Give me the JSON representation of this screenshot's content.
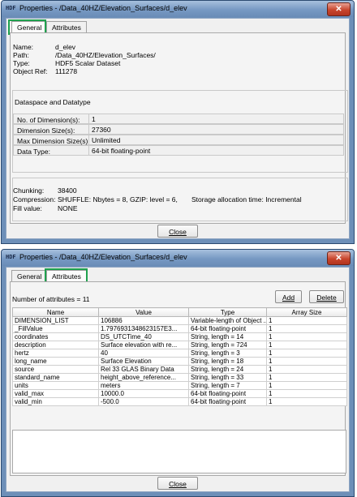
{
  "window1": {
    "title": "Properties - /Data_40HZ/Elevation_Surfaces/d_elev",
    "tabs": [
      {
        "label": "General"
      },
      {
        "label": "Attributes"
      }
    ],
    "general": {
      "name_label": "Name:",
      "name_value": "d_elev",
      "path_label": "Path:",
      "path_value": "/Data_40HZ/Elevation_Surfaces/",
      "type_label": "Type:",
      "type_value": "HDF5 Scalar Dataset",
      "objref_label": "Object Ref:",
      "objref_value": "111278"
    },
    "dataspace": {
      "title": "Dataspace and Datatype",
      "fields": [
        {
          "label": "No. of Dimension(s):",
          "value": "1"
        },
        {
          "label": "Dimension Size(s):",
          "value": "27360"
        },
        {
          "label": "Max Dimension Size(s):",
          "value": "Unlimited"
        },
        {
          "label": "Data Type:",
          "value": "64-bit floating-point"
        }
      ]
    },
    "storage": {
      "chunking_label": "Chunking:",
      "chunking_value": "38400",
      "compression_label": "Compression:",
      "compression_value": "SHUFFLE: Nbytes = 8, GZIP: level = 6,",
      "allocation_text": "Storage allocation time: Incremental",
      "fill_label": "Fill value:",
      "fill_value": "NONE"
    },
    "close_label": "Close"
  },
  "window2": {
    "title": "Properties - /Data_40HZ/Elevation_Surfaces/d_elev",
    "tabs": [
      {
        "label": "General"
      },
      {
        "label": "Attributes"
      }
    ],
    "attr_count_text": "Number of attributes = 11",
    "add_label": "Add",
    "delete_label": "Delete",
    "columns": [
      "Name",
      "Value",
      "Type",
      "Array Size"
    ],
    "rows": [
      [
        "DIMENSION_LIST",
        "106886",
        "Variable-length of Object ...",
        "1"
      ],
      [
        "_FillValue",
        "1.7976931348623157E3...",
        "64-bit floating-point",
        "1"
      ],
      [
        "coordinates",
        "DS_UTCTime_40",
        "String, length = 14",
        "1"
      ],
      [
        "description",
        "Surface elevation with re...",
        "String, length = 724",
        "1"
      ],
      [
        "hertz",
        "40",
        "String, length = 3",
        "1"
      ],
      [
        "long_name",
        "Surface Elevation",
        "String, length = 18",
        "1"
      ],
      [
        "source",
        "Rel 33 GLAS Binary Data",
        "String, length = 24",
        "1"
      ],
      [
        "standard_name",
        "height_above_reference...",
        "String, length = 33",
        "1"
      ],
      [
        "units",
        "meters",
        "String, length = 7",
        "1"
      ],
      [
        "valid_max",
        "10000.0",
        "64-bit floating-point",
        "1"
      ],
      [
        "valid_min",
        "-500.0",
        "64-bit floating-point",
        "1"
      ]
    ],
    "close_label": "Close"
  },
  "colors": {
    "highlight": "#1fa14e",
    "titlebar": "#7799c3",
    "close_button": "#c8452d"
  }
}
